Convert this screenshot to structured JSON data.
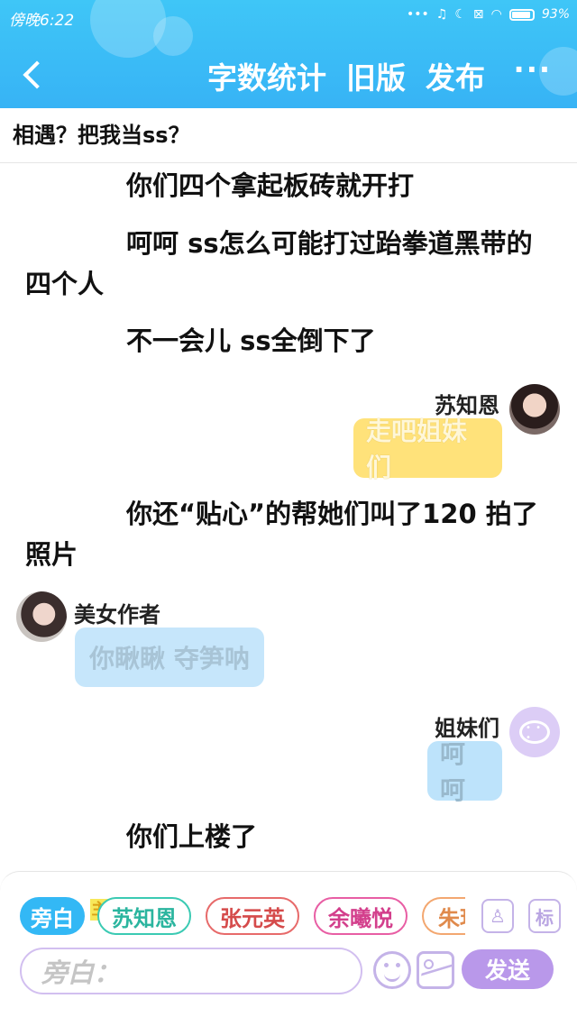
{
  "status_bar": {
    "time": "傍晚6:22",
    "battery_percent": "93%"
  },
  "nav": {
    "word_count_label": "字数统计",
    "old_version_label": "旧版",
    "publish_label": "发布",
    "more_label": "···"
  },
  "chapter_title": "相遇？把我当ss？",
  "story": {
    "narration_1": "你们四个拿起板砖就开打",
    "narration_2": "呵呵 ss怎么可能打过跆拳道黑带的四个人",
    "narration_3": "不一会儿 ss全倒下了",
    "msg_1_speaker": "苏知恩",
    "msg_1_text": "走吧姐妹们",
    "narration_4": "你还“贴心”的帮她们叫了120 拍了照片",
    "msg_2_speaker": "美女作者",
    "msg_2_text": "你瞅瞅 夺笋呐",
    "msg_3_speaker": "姐妹们",
    "msg_3_text": "呵呵",
    "narration_5": "你们上楼了"
  },
  "roles": {
    "narrator": "旁白",
    "host_badge": "主",
    "role_1": "苏知恩",
    "role_2": "张元英",
    "role_3": "余曦悦",
    "role_4": "朱玥",
    "tag_button": "标"
  },
  "input": {
    "placeholder": "旁白：",
    "send_label": "发送"
  },
  "colors": {
    "header": "#37b3f5",
    "accent_purple": "#b998ea",
    "bubble_yellow": "#ffe27a",
    "bubble_blue": "#c6e6fb"
  }
}
